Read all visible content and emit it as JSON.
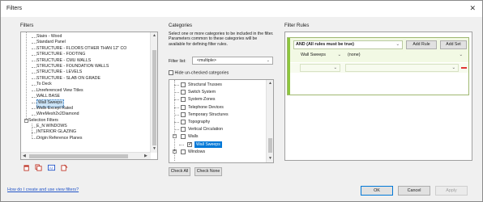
{
  "window": {
    "title": "Filters",
    "close_glyph": "✕"
  },
  "filters": {
    "section_label": "Filters",
    "tree": [
      {
        "label": "Stairs - Wood",
        "level": 1
      },
      {
        "label": "Standard Panel",
        "level": 1
      },
      {
        "label": "STRUCTURE - FLOORS OTHER THAN 12\" CO",
        "level": 1
      },
      {
        "label": "STRUCTURE - FOOTING",
        "level": 1
      },
      {
        "label": "STRUCTURE - CMU WALLS",
        "level": 1
      },
      {
        "label": "STRUCTURE - FOUNDATION WALLS",
        "level": 1
      },
      {
        "label": "STRUCTURE - LEVELS",
        "level": 1
      },
      {
        "label": "STRUCTURE - SLAB ON GRADE",
        "level": 1
      },
      {
        "label": "To Deck",
        "level": 1
      },
      {
        "label": "Unreferenced View Titles",
        "level": 1
      },
      {
        "label": "WALL BASE",
        "level": 1
      },
      {
        "label": "Wall Sweeps",
        "level": 1,
        "selected": true
      },
      {
        "label": "Walls Except Rated",
        "level": 1
      },
      {
        "label": "WireMesh2x2Diamond",
        "level": 1
      },
      {
        "label": "Selection Filters",
        "level": 0,
        "toggle": "−"
      },
      {
        "label": "E_N WINDOWS",
        "level": 1
      },
      {
        "label": "INTERIOR GLAZING",
        "level": 1
      },
      {
        "label": "Origin Reference Planes",
        "level": 1
      }
    ],
    "tools": [
      "new-filter-icon",
      "duplicate-filter-icon",
      "rename-filter-icon",
      "delete-filter-icon"
    ]
  },
  "categories": {
    "section_label": "Categories",
    "description": "Select one or more categories to be included in the filter. Parameters common to these categories will be available for defining filter rules.",
    "filter_list_label": "Filter list:",
    "filter_list_value": "<multiple>",
    "hide_unchecked_label": "Hide un-checked categories",
    "items": [
      {
        "label": "Structural Trusses",
        "checked": false,
        "level": 1
      },
      {
        "label": "Switch System",
        "checked": false,
        "level": 1
      },
      {
        "label": "System-Zones",
        "checked": false,
        "level": 1
      },
      {
        "label": "Telephone Devices",
        "checked": false,
        "level": 1
      },
      {
        "label": "Temporary Structures",
        "checked": false,
        "level": 1
      },
      {
        "label": "Topography",
        "checked": false,
        "level": 1
      },
      {
        "label": "Vertical Circulation",
        "checked": false,
        "level": 1
      },
      {
        "label": "Walls",
        "checked": false,
        "level": 1,
        "toggle": "−"
      },
      {
        "label": "Wall Sweeps",
        "checked": true,
        "level": 2,
        "selected": true
      },
      {
        "label": "Windows",
        "checked": false,
        "level": 1,
        "toggle": "+"
      }
    ],
    "check_all": "Check All",
    "check_none": "Check None"
  },
  "rules": {
    "section_label": "Filter Rules",
    "and_value": "AND (All rules must be true)",
    "add_rule": "Add Rule",
    "add_set": "Add Set",
    "field_value": "Wall Sweeps",
    "operator_value": "(none)",
    "accent_color": "#8dc63f"
  },
  "footer": {
    "help_link": "How do I create and use view filters?",
    "ok": "OK",
    "cancel": "Cancel",
    "apply": "Apply"
  }
}
